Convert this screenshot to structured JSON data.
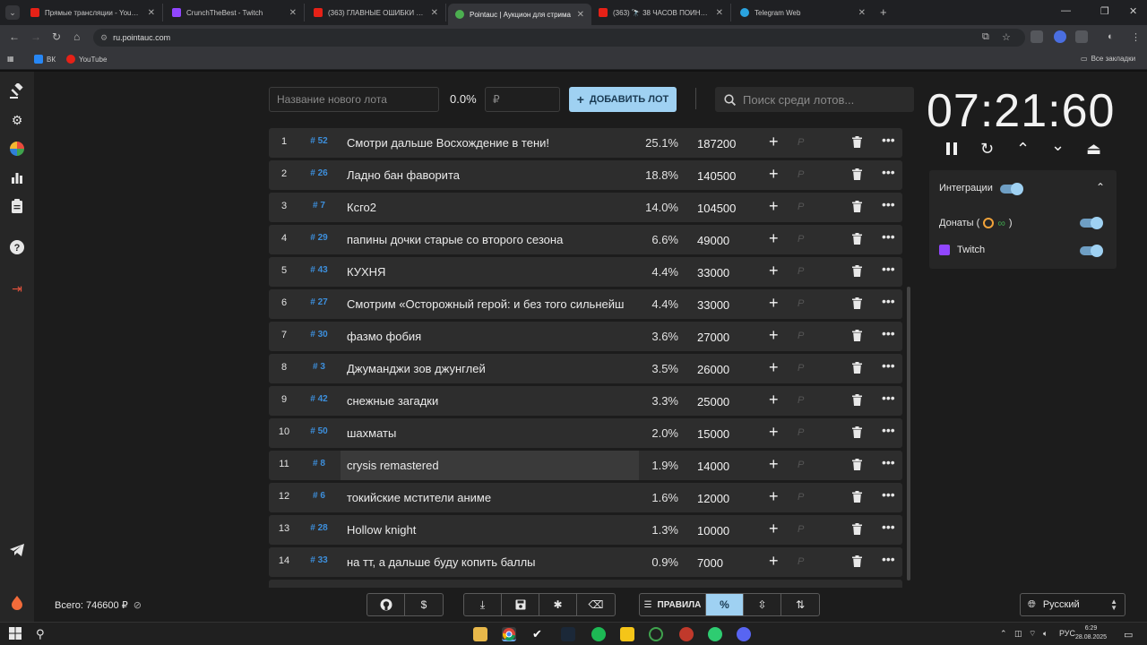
{
  "browser": {
    "tabs": [
      {
        "title": "Прямые трансляции - YouTube",
        "color": "#e62117"
      },
      {
        "title": "CrunchTheBest - Twitch",
        "color": "#9146ff"
      },
      {
        "title": "(363) ГЛАВНЫЕ ОШИБКИ ИГР",
        "color": "#e62117"
      },
      {
        "title": "Pointauc | Аукцион для стрима",
        "color": "#4caf50"
      },
      {
        "title": "(363) 🔭 38 ЧАСОВ ПОИНТОВ",
        "color": "#e62117"
      },
      {
        "title": "Telegram Web",
        "color": "#2aa3df"
      }
    ],
    "url": "ru.pointauc.com",
    "bookmarks": [
      "ВК",
      "YouTube"
    ],
    "all_bookmarks": "Все закладки"
  },
  "controls": {
    "lot_name_placeholder": "Название нового лота",
    "lot_percent": "0.0%",
    "lot_amount_placeholder": "₽",
    "add_button": "ДОБАВИТЬ ЛОТ",
    "search_placeholder": "Поиск среди лотов..."
  },
  "lots": [
    {
      "index": "1",
      "fid": "# 52",
      "name": "Смотри дальше Восхождение в тени!",
      "percent": "25.1%",
      "amount": "187200"
    },
    {
      "index": "2",
      "fid": "# 26",
      "name": "Ладно бан фаворита",
      "percent": "18.8%",
      "amount": "140500"
    },
    {
      "index": "3",
      "fid": "# 7",
      "name": "Ксго2",
      "percent": "14.0%",
      "amount": "104500"
    },
    {
      "index": "4",
      "fid": "# 29",
      "name": "папины дочки старые со второго сезона",
      "percent": "6.6%",
      "amount": "49000"
    },
    {
      "index": "5",
      "fid": "# 43",
      "name": "КУХНЯ",
      "percent": "4.4%",
      "amount": "33000"
    },
    {
      "index": "6",
      "fid": "# 27",
      "name": "Смотрим «Осторожный герой: и без того сильнейш",
      "percent": "4.4%",
      "amount": "33000"
    },
    {
      "index": "7",
      "fid": "# 30",
      "name": "фазмо фобия",
      "percent": "3.6%",
      "amount": "27000"
    },
    {
      "index": "8",
      "fid": "# 3",
      "name": "Джуманджи зов джунглей",
      "percent": "3.5%",
      "amount": "26000"
    },
    {
      "index": "9",
      "fid": "# 42",
      "name": "снежные загадки",
      "percent": "3.3%",
      "amount": "25000"
    },
    {
      "index": "10",
      "fid": "# 50",
      "name": "шахматы",
      "percent": "2.0%",
      "amount": "15000"
    },
    {
      "index": "11",
      "fid": "# 8",
      "name": "crysis remastered",
      "percent": "1.9%",
      "amount": "14000"
    },
    {
      "index": "12",
      "fid": "# 6",
      "name": "токийские мстители аниме",
      "percent": "1.6%",
      "amount": "12000"
    },
    {
      "index": "13",
      "fid": "# 28",
      "name": "Hollow knight",
      "percent": "1.3%",
      "amount": "10000"
    },
    {
      "index": "14",
      "fid": "# 33",
      "name": "на тт, а дальше буду копить баллы",
      "percent": "0.9%",
      "amount": "7000"
    }
  ],
  "timer": "07:21:60",
  "integrations": {
    "title": "Интеграции",
    "donations": "Донаты (",
    "donations_close": ")",
    "twitch": "Twitch"
  },
  "footer": {
    "total": "Всего: 746600 ₽",
    "rules": "ПРАВИЛА",
    "language": "Русский"
  },
  "taskbar": {
    "lang": "РУС",
    "time": "6:29",
    "date": "28.08.2025"
  }
}
